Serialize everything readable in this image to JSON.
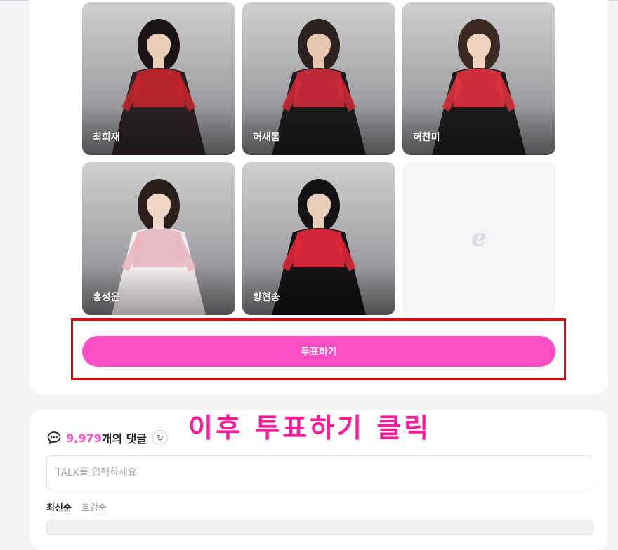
{
  "cards": [
    {
      "name": "최희재",
      "dress": "#2a2125",
      "accent": "#c4242c",
      "hair": "#1b1416",
      "skin": "#e9cdb9"
    },
    {
      "name": "허새롬",
      "dress": "#1a1a1c",
      "accent": "#d22a3a",
      "hair": "#2b2220",
      "skin": "#e6c6ae"
    },
    {
      "name": "허찬미",
      "dress": "#1d1a1c",
      "accent": "#e0323f",
      "hair": "#3a2a22",
      "skin": "#efd3bf"
    },
    {
      "name": "홍성윤",
      "dress": "#f4eeee",
      "accent": "#e6b5be",
      "hair": "#2b1f1c",
      "skin": "#f0d6c6"
    },
    {
      "name": "황현송",
      "dress": "#141214",
      "accent": "#e3283a",
      "hair": "#151213",
      "skin": "#e9cdbb"
    },
    {
      "name": "",
      "placeholder_logo": "e"
    }
  ],
  "vote_button": {
    "label": "투표하기"
  },
  "annotation": {
    "text": "이후 투표하기 클릭"
  },
  "comments": {
    "count": "9,979",
    "count_suffix": "개의 댓글",
    "input_placeholder": "TALK를 입력하세요",
    "sort": {
      "latest": "최신순",
      "popular": "호감순"
    }
  },
  "colors": {
    "brand_pink": "#fb4ec4",
    "annotation_pink": "#ff1a9a",
    "highlight_red": "#e8000b"
  }
}
